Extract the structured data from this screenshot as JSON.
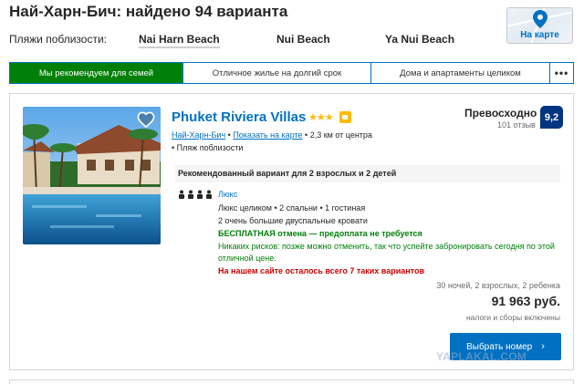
{
  "header": {
    "title": "Най-Харн-Бич: найдено 94 варианта"
  },
  "nearby": {
    "label": "Пляжи поблизости:",
    "beaches": [
      "Nai Harn Beach",
      "Nui Beach",
      "Ya Nui Beach"
    ]
  },
  "map": {
    "label": "На карте",
    "icon": "map-pin-icon"
  },
  "tabs": [
    {
      "label": "Мы рекомендуем для семей",
      "active": true
    },
    {
      "label": "Отличное жилье на долгий срок",
      "active": false
    },
    {
      "label": "Дома и апартаменты целиком",
      "active": false
    },
    {
      "label": "•••",
      "active": false
    }
  ],
  "hotel": {
    "name": "Phuket Riviera Villas",
    "stars": "★★★",
    "location_link": "Най-Харн-Бич",
    "show_on_map": "Показать на карте",
    "distance": "2,3 км от центра",
    "beach_nearby": "Пляж поблизости",
    "score_word": "Превосходно",
    "reviews": "101 отзыв",
    "score": "9,2",
    "recommended": "Рекомендованный вариант для 2 взрослых и 2 детей",
    "room_name": "Люкс",
    "room_details": "Люкс целиком • 2 спальни • 1 гостиная",
    "beds": "2 очень большие двуспальные кровати",
    "free_cancel": "БЕСПЛАТНАЯ отмена — предоплата не требуется",
    "no_risk": "Никаких рисков: позже можно отменить, так что успейте забронировать сегодня по этой отличной цене.",
    "scarcity": "На нашем сайте осталось всего 7 таких вариантов",
    "stay_info": "30 ночей, 2 взрослых, 2 ребенка",
    "price": "91 963 руб.",
    "taxes": "налоги и сборы включены",
    "cta": "Выбрать номер",
    "cta_chevron": "›"
  },
  "watermark": "YAPLAKAL.COM",
  "colors": {
    "link_blue": "#0071c2",
    "score_navy": "#003580",
    "green": "#008009",
    "red": "#cc0000",
    "star_yellow": "#febb02"
  }
}
